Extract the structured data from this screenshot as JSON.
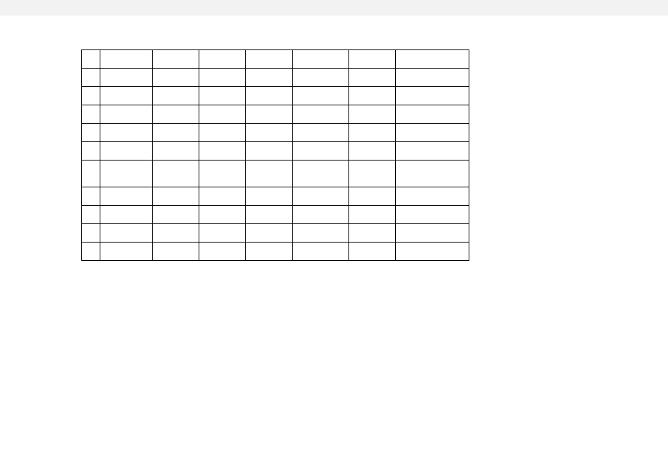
{
  "page": {
    "background_outer": "#f2f2f2",
    "background_page": "#ffffff",
    "border_color": "#000000"
  },
  "table": {
    "columns": 8,
    "rows": [
      {
        "style": "thick",
        "cells": [
          "",
          "",
          "",
          "",
          "",
          "",
          "",
          ""
        ]
      },
      {
        "style": "thick",
        "cells": [
          "",
          "",
          "",
          "",
          "",
          "",
          "",
          ""
        ]
      },
      {
        "style": "thick",
        "cells": [
          "",
          "",
          "",
          "",
          "",
          "",
          "",
          ""
        ]
      },
      {
        "style": "thick",
        "cells": [
          "",
          "",
          "",
          "",
          "",
          "",
          "",
          ""
        ]
      },
      {
        "style": "thick",
        "cells": [
          "",
          "",
          "",
          "",
          "",
          "",
          "",
          ""
        ]
      },
      {
        "style": "thick",
        "cells": [
          "",
          "",
          "",
          "",
          "",
          "",
          "",
          ""
        ]
      },
      {
        "style": "thick",
        "cells": [
          "",
          "",
          "",
          "",
          "",
          "",
          "",
          ""
        ]
      },
      {
        "style": "thin",
        "cells": [
          "",
          "",
          "",
          "",
          "",
          "",
          "",
          ""
        ]
      },
      {
        "style": "thin",
        "cells": [
          "",
          "",
          "",
          "",
          "",
          "",
          "",
          ""
        ]
      },
      {
        "style": "thin",
        "cells": [
          "",
          "",
          "",
          "",
          "",
          "",
          "",
          ""
        ]
      },
      {
        "style": "thin",
        "cells": [
          "",
          "",
          "",
          "",
          "",
          "",
          "",
          ""
        ]
      }
    ]
  }
}
